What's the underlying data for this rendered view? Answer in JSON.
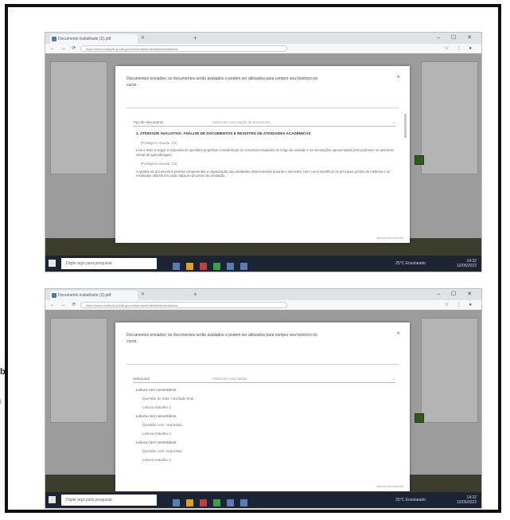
{
  "edge": {
    "mark": "b",
    "mark2": "i"
  },
  "screens": [
    {
      "browser": {
        "tab_title": "Documento trabalhado (2).pdf",
        "url": "https://www.example-portal.gov.br/estudante/atividades/avaliacao",
        "window_controls": "– ☐ ✕"
      },
      "modal": {
        "title": "Documentos enviados: os documentos serão avaliados e podem ser utilizados para compor seu histórico no curso.",
        "filter_label": "Tipo de documento",
        "filter_value": "Selecione uma opção de documento",
        "heading": "1. ATIVIDADE AVALIATIVA: ANÁLISE DE DOCUMENTOS E REGISTRO DE ATIVIDADES ACADÊMICAS",
        "small_1": "(Postagem enviada: 1/2)",
        "para_1": "Leia o texto a seguir e responda às questões propostas considerando os conceitos estudados ao longo da unidade e as orientações apresentadas pelo professor no ambiente virtual de aprendizagem.",
        "small_2": "(Postagem enviada: 2/2)",
        "para_2": "A análise de documentos permite compreender a organização das atividades desenvolvidas durante o semestre, bem como identificar os principais pontos de melhoria e os resultados obtidos em cada etapa do processo de avaliação.",
        "footer": "Anexar documento"
      },
      "taskbar": {
        "search": "Digite aqui para pesquisar",
        "weather": "25°C Ensolarado",
        "time": "14:32",
        "date": "12/05/2022"
      }
    },
    {
      "browser": {
        "tab_title": "Documento trabalhado (2).pdf",
        "url": "https://www.example-portal.gov.br/estudante/atividades/avaliacao",
        "window_controls": "– ☐ ✕"
      },
      "modal": {
        "title": "Documentos enviados: os documentos serão avaliados e podem ser utilizados para compor seu histórico no curso.",
        "filter_label": "Selecionar",
        "filter_value": "Selecione uma opção",
        "items": [
          "Leitura com comentários",
          "Questão de sala: Atividade final",
          "Leitura trabalho 2",
          "Leitura com comentários",
          "Questão com: respostas",
          "Leitura trabalho 2",
          "Leitura com comentários",
          "Questão com: respostas",
          "Leitura trabalho 2"
        ],
        "footer": "Anexar documento"
      },
      "taskbar": {
        "search": "Digite aqui para pesquisar",
        "weather": "25°C Ensolarado",
        "time": "14:32",
        "date": "12/05/2022"
      }
    }
  ]
}
